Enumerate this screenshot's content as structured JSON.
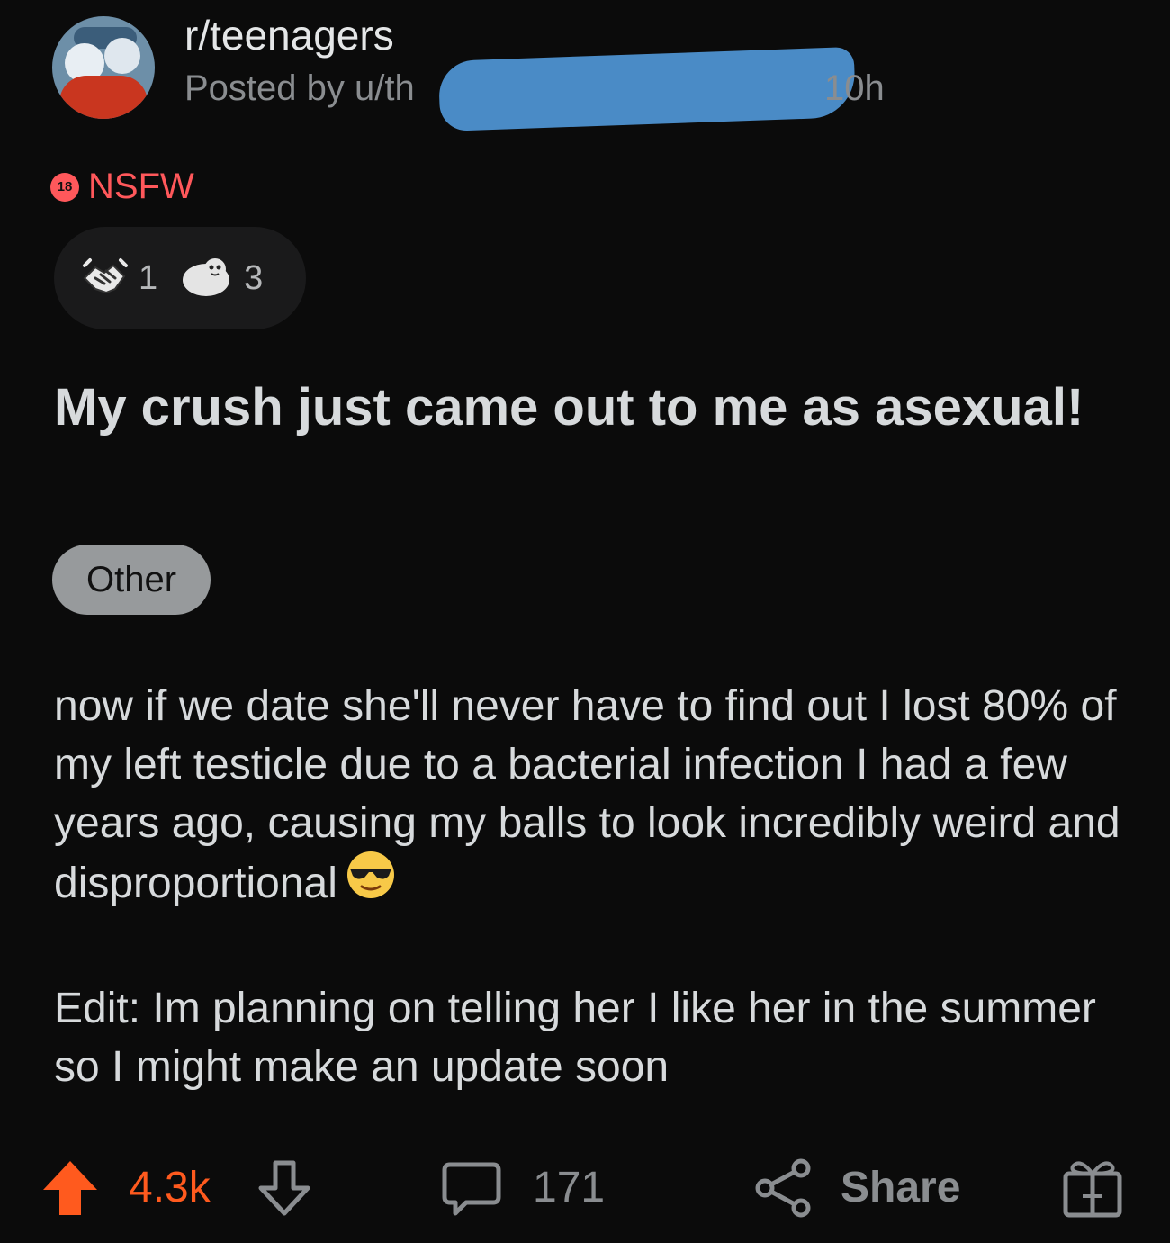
{
  "post": {
    "subreddit": "r/teenagers",
    "posted_by_prefix": "Posted by u/th",
    "age": "10h",
    "nsfw_badge": "18",
    "nsfw_label": "NSFW",
    "awards": [
      {
        "icon": "handshake-award-icon",
        "count": "1"
      },
      {
        "icon": "seal-award-icon",
        "count": "3"
      }
    ],
    "title": "My crush just came out to me as asexual!",
    "flair": "Other",
    "body": [
      "now if we date she'll never have to find out I lost 80% of my left testicle due to a bacterial infection I had a few years ago, causing my balls to look incredibly weird and disproportional",
      "Edit: Im planning on telling her I like her in the summer so I might make an update soon"
    ],
    "body_emoji": "sunglasses-face-icon"
  },
  "actions": {
    "upvote_icon": "upvote-arrow-icon",
    "vote_count": "4.3k",
    "downvote_icon": "downvote-arrow-icon",
    "comment_icon": "comment-bubble-icon",
    "comment_count": "171",
    "share_icon": "share-icon",
    "share_label": "Share",
    "gift_icon": "gift-award-icon"
  },
  "colors": {
    "background": "#0b0b0b",
    "nsfw": "#ff585b",
    "upvote": "#ff5a1e",
    "redaction": "#4a8bc6"
  }
}
